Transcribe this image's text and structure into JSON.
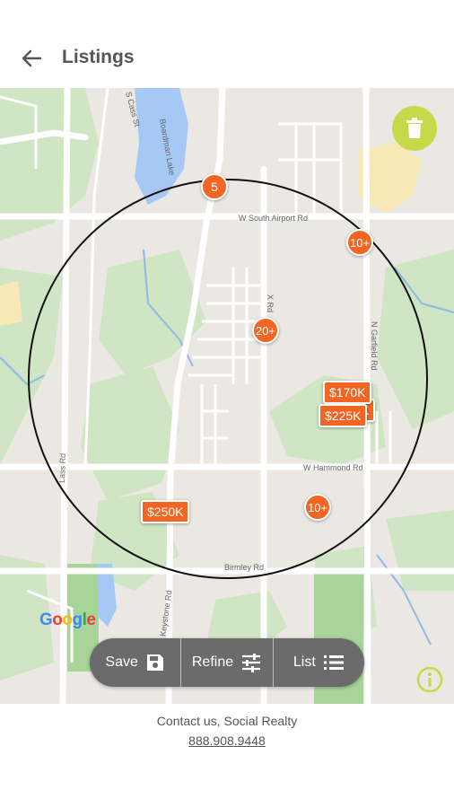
{
  "header": {
    "title": "Listings"
  },
  "map": {
    "roads": {
      "airport": "W South Airport Rd",
      "hammond": "W Hammond Rd",
      "birmley": "Birmley Rd",
      "keystone": "N Keystone Rd",
      "garfield": "N Garfield Rd",
      "cass": "S Cass St",
      "lake": "Boardman Lake",
      "lass": "Lass Rd",
      "x_rd": "X Rd"
    },
    "clusters": [
      {
        "label": "5"
      },
      {
        "label": "10+"
      },
      {
        "label": "20+"
      },
      {
        "label": "10+"
      }
    ],
    "prices": [
      {
        "label": "$170K"
      },
      {
        "label": "K"
      },
      {
        "label": "$225K"
      },
      {
        "label": "$250K"
      }
    ],
    "google_logo": "Google"
  },
  "actions": {
    "save": "Save",
    "refine": "Refine",
    "list": "List"
  },
  "footer": {
    "contact": "Contact us, Social Realty",
    "phone": "888.908.9448"
  },
  "colors": {
    "accent": "#f26522",
    "trash": "#c5d94a",
    "action_bar": "#6b6b6b"
  }
}
